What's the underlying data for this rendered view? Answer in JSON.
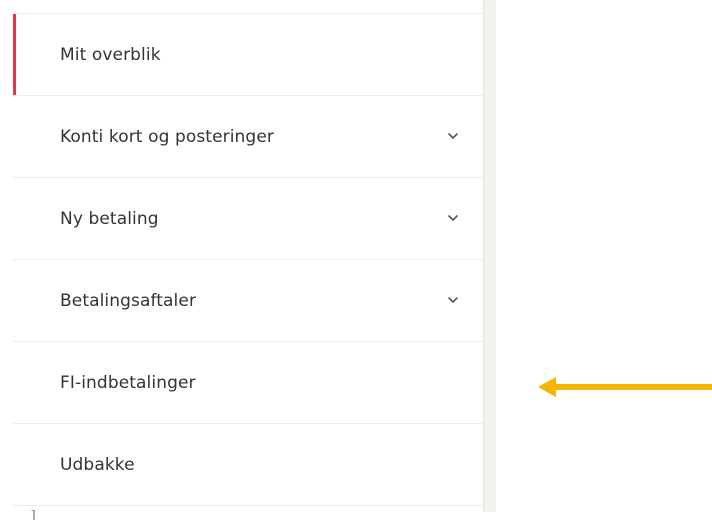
{
  "sidebar": {
    "items": [
      {
        "label": "Mit overblik",
        "active": true,
        "has_chevron": false
      },
      {
        "label": "Konti kort og posteringer",
        "active": false,
        "has_chevron": true
      },
      {
        "label": "Ny betaling",
        "active": false,
        "has_chevron": true
      },
      {
        "label": "Betalingsaftaler",
        "active": false,
        "has_chevron": true
      },
      {
        "label": "FI-indbetalinger",
        "active": false,
        "has_chevron": false
      },
      {
        "label": "Udbakke",
        "active": false,
        "has_chevron": false
      }
    ]
  },
  "icons": {
    "chevron": "chevron-down-icon",
    "annotation": "left-arrow-icon"
  },
  "colors": {
    "active_indicator": "#e8344e",
    "annotation_arrow": "#f5b400",
    "text": "#333333",
    "divider": "#ececec"
  }
}
